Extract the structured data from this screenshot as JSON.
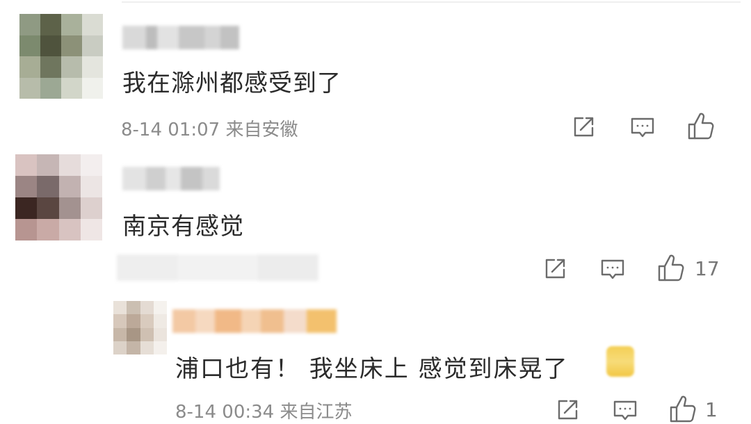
{
  "comments": [
    {
      "text": "我在滁州都感受到了",
      "timestamp": "8-14 01:07",
      "location": "来自安徽",
      "likes": null
    },
    {
      "text": "南京有感觉",
      "likes": "17"
    },
    {
      "text": "浦口也有！ 我坐床上 感觉到床晃了",
      "timestamp": "8-14 00:34",
      "location": "来自江苏",
      "likes": "1"
    }
  ],
  "icons": [
    "share-icon",
    "comment-icon",
    "like-icon"
  ],
  "colors": {
    "text": "#2b2b2b",
    "meta": "#8b8b8b",
    "icon": "#6b6b6b"
  }
}
